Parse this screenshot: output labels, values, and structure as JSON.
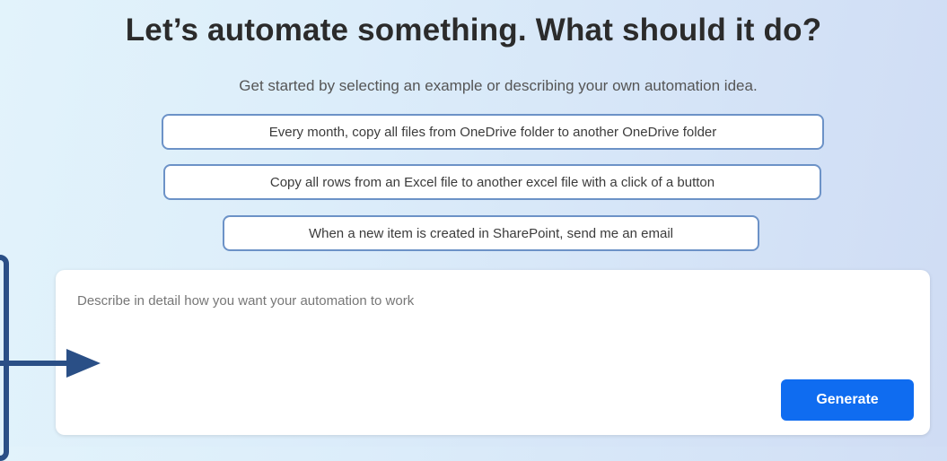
{
  "header": {
    "title": "Let’s automate something. What should it do?",
    "subtitle": "Get started by selecting an example or describing your own automation idea."
  },
  "suggestions": [
    {
      "label": "Every month, copy all files from OneDrive folder to another OneDrive folder"
    },
    {
      "label": "Copy all rows from an Excel file to another excel file with a click of a button"
    },
    {
      "label": "When a new item is created in SharePoint, send me an email"
    }
  ],
  "prompt": {
    "placeholder": "Describe in detail how you want your automation to work",
    "value": "",
    "generate_label": "Generate"
  },
  "colors": {
    "accent": "#0f6cf0",
    "suggestion_border": "#6c92c7",
    "callout": "#2a4f86"
  },
  "icons": {
    "callout": "right-arrow-icon"
  }
}
